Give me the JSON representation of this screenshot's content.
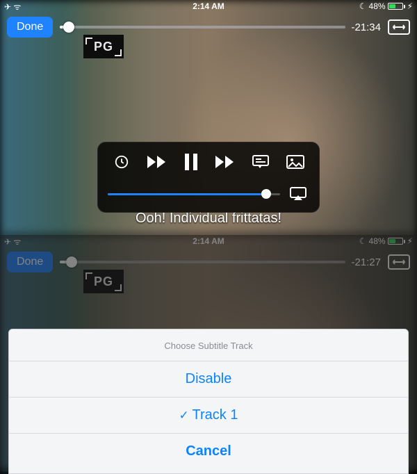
{
  "device": {
    "pane1": {
      "time": "2:14 AM",
      "battery_pct": "48%",
      "airplane": "✈",
      "wifi": "ᯤ",
      "moon": "☾",
      "bolt": "⚡︎"
    },
    "pane2": {
      "time": "2:14 AM",
      "battery_pct": "48%",
      "airplane": "✈",
      "wifi": "ᯤ",
      "moon": "☾",
      "bolt": "⚡︎"
    }
  },
  "player": {
    "done": "Done",
    "rating": "PG",
    "remaining1": "-21:34",
    "remaining2": "-21:27",
    "fullscreen_glyph": "⟷",
    "subtitle_text": "Ooh! Individual frittatas!"
  },
  "sheet": {
    "title": "Choose Subtitle Track",
    "options": [
      "Disable",
      "Track 1"
    ],
    "selected_index": 1,
    "cancel": "Cancel"
  }
}
